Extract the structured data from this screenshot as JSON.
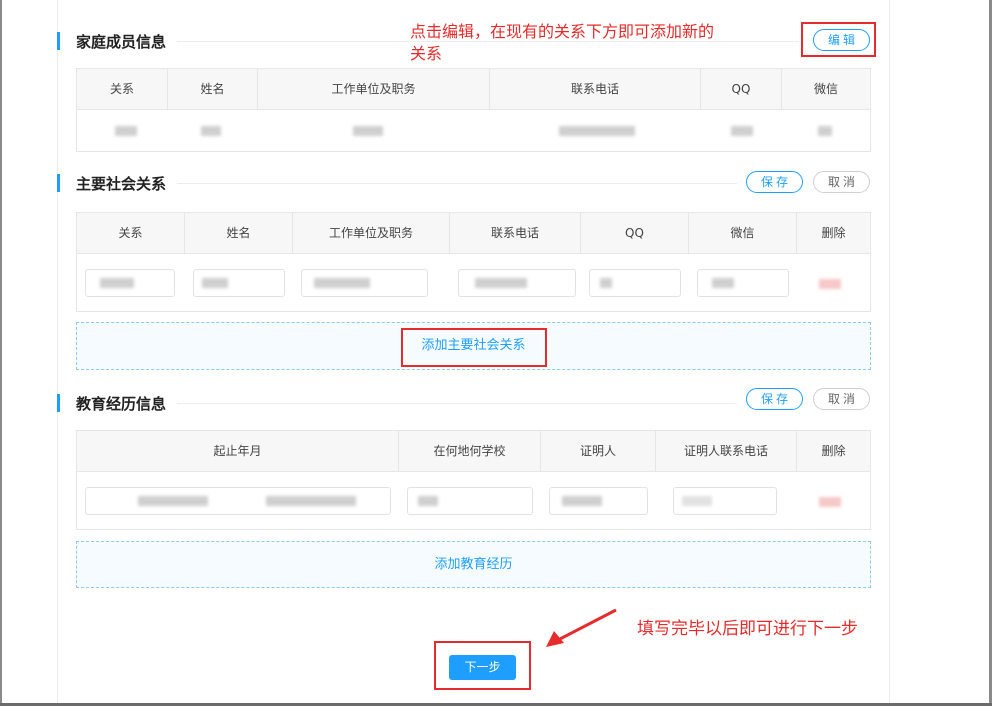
{
  "family": {
    "title": "家庭成员信息",
    "edit_label": "编辑",
    "columns": [
      "关系",
      "姓名",
      "工作单位及职务",
      "联系电话",
      "QQ",
      "微信"
    ]
  },
  "social": {
    "title": "主要社会关系",
    "save_label": "保存",
    "cancel_label": "取消",
    "columns": [
      "关系",
      "姓名",
      "工作单位及职务",
      "联系电话",
      "QQ",
      "微信",
      "删除"
    ],
    "add_label": "添加主要社会关系"
  },
  "education": {
    "title": "教育经历信息",
    "save_label": "保存",
    "cancel_label": "取消",
    "columns": [
      "起止年月",
      "在何地何学校",
      "证明人",
      "证明人联系电话",
      "删除"
    ],
    "add_label": "添加教育经历"
  },
  "next_label": "下一步",
  "annotations": {
    "edit_hint_line1": "点击编辑，在现有的关系下方即可添加新的",
    "edit_hint_line2": "关系",
    "next_hint": "填写完毕以后即可进行下一步"
  },
  "colors": {
    "accent": "#1e9fff",
    "annotation": "#e52b2b",
    "header_bg": "#f7f7f7",
    "border": "#e6e6e6"
  }
}
